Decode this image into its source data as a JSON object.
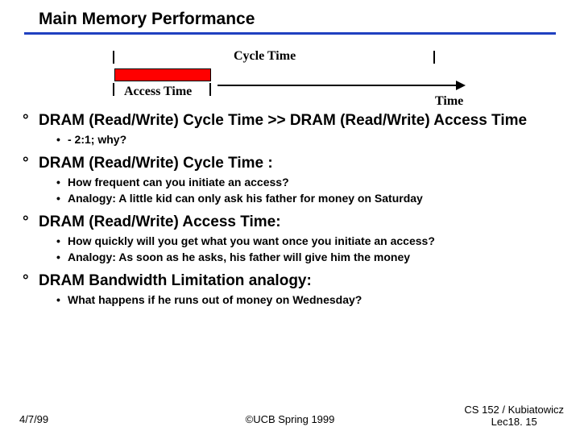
{
  "title": "Main Memory Performance",
  "diagram": {
    "cycle_label": "Cycle Time",
    "access_label": "Access Time",
    "time_label": "Time"
  },
  "bullets": [
    {
      "text": "DRAM (Read/Write) Cycle Time  >>  DRAM (Read/Write) Access Time",
      "subs": [
        "- 2:1; why?"
      ]
    },
    {
      "text": "DRAM (Read/Write) Cycle Time :",
      "subs": [
        "How frequent can you initiate an access?",
        "Analogy: A little kid can only ask his father for money on Saturday"
      ]
    },
    {
      "text": "DRAM (Read/Write) Access Time:",
      "subs": [
        "How quickly will you get what you want once you initiate an access?",
        "Analogy: As soon as he asks, his father will give him the money"
      ]
    },
    {
      "text": "DRAM Bandwidth Limitation analogy:",
      "subs": [
        "What happens if he runs out of money on Wednesday?"
      ]
    }
  ],
  "footer": {
    "left": "4/7/99",
    "center": "©UCB Spring 1999",
    "right_line1": "CS 152 / Kubiatowicz",
    "right_line2": "Lec18. 15"
  }
}
